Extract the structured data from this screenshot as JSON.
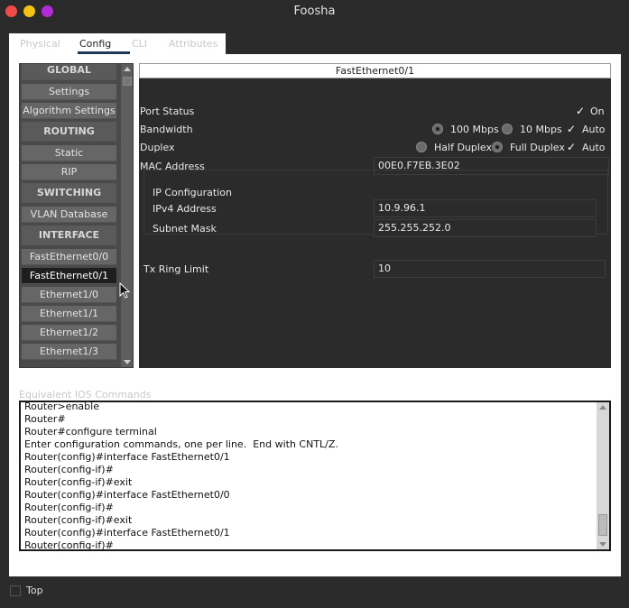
{
  "window": {
    "title": "Foosha"
  },
  "tabs": [
    {
      "label": "Physical"
    },
    {
      "label": "Config"
    },
    {
      "label": "CLI"
    },
    {
      "label": "Attributes"
    }
  ],
  "sidebar": {
    "items": [
      {
        "label": "GLOBAL",
        "kind": "header"
      },
      {
        "label": "Settings"
      },
      {
        "label": "Algorithm Settings"
      },
      {
        "label": "ROUTING",
        "kind": "header"
      },
      {
        "label": "Static"
      },
      {
        "label": "RIP"
      },
      {
        "label": "SWITCHING",
        "kind": "header"
      },
      {
        "label": "VLAN Database"
      },
      {
        "label": "INTERFACE",
        "kind": "header"
      },
      {
        "label": "FastEthernet0/0"
      },
      {
        "label": "FastEthernet0/1",
        "selected": true
      },
      {
        "label": "Ethernet1/0"
      },
      {
        "label": "Ethernet1/1"
      },
      {
        "label": "Ethernet1/2"
      },
      {
        "label": "Ethernet1/3"
      }
    ]
  },
  "config": {
    "header": "FastEthernet0/1",
    "port_status": {
      "label": "Port Status",
      "on_label": "On",
      "checked": true
    },
    "bandwidth": {
      "label": "Bandwidth",
      "opt1": "100 Mbps",
      "opt2": "10 Mbps",
      "auto": "Auto"
    },
    "duplex": {
      "label": "Duplex",
      "opt1": "Half Duplex",
      "opt2": "Full Duplex",
      "auto": "Auto"
    },
    "mac": {
      "label": "MAC Address",
      "value": "00E0.F7EB.3E02"
    },
    "ip": {
      "group_label": "IP Configuration",
      "ipv4_label": "IPv4 Address",
      "ipv4_value": "10.9.96.1",
      "mask_label": "Subnet Mask",
      "mask_value": "255.255.252.0"
    },
    "tx": {
      "label": "Tx Ring Limit",
      "value": "10"
    }
  },
  "ios": {
    "label": "Equivalent IOS Commands",
    "lines": [
      "Router>enable",
      "Router#",
      "Router#configure terminal",
      "Enter configuration commands, one per line.  End with CNTL/Z.",
      "Router(config)#interface FastEthernet0/1",
      "Router(config-if)#",
      "Router(config-if)#exit",
      "Router(config)#interface FastEthernet0/0",
      "Router(config-if)#",
      "Router(config-if)#exit",
      "Router(config)#interface FastEthernet0/1",
      "Router(config-if)#"
    ]
  },
  "bottom": {
    "top_label": "Top"
  }
}
